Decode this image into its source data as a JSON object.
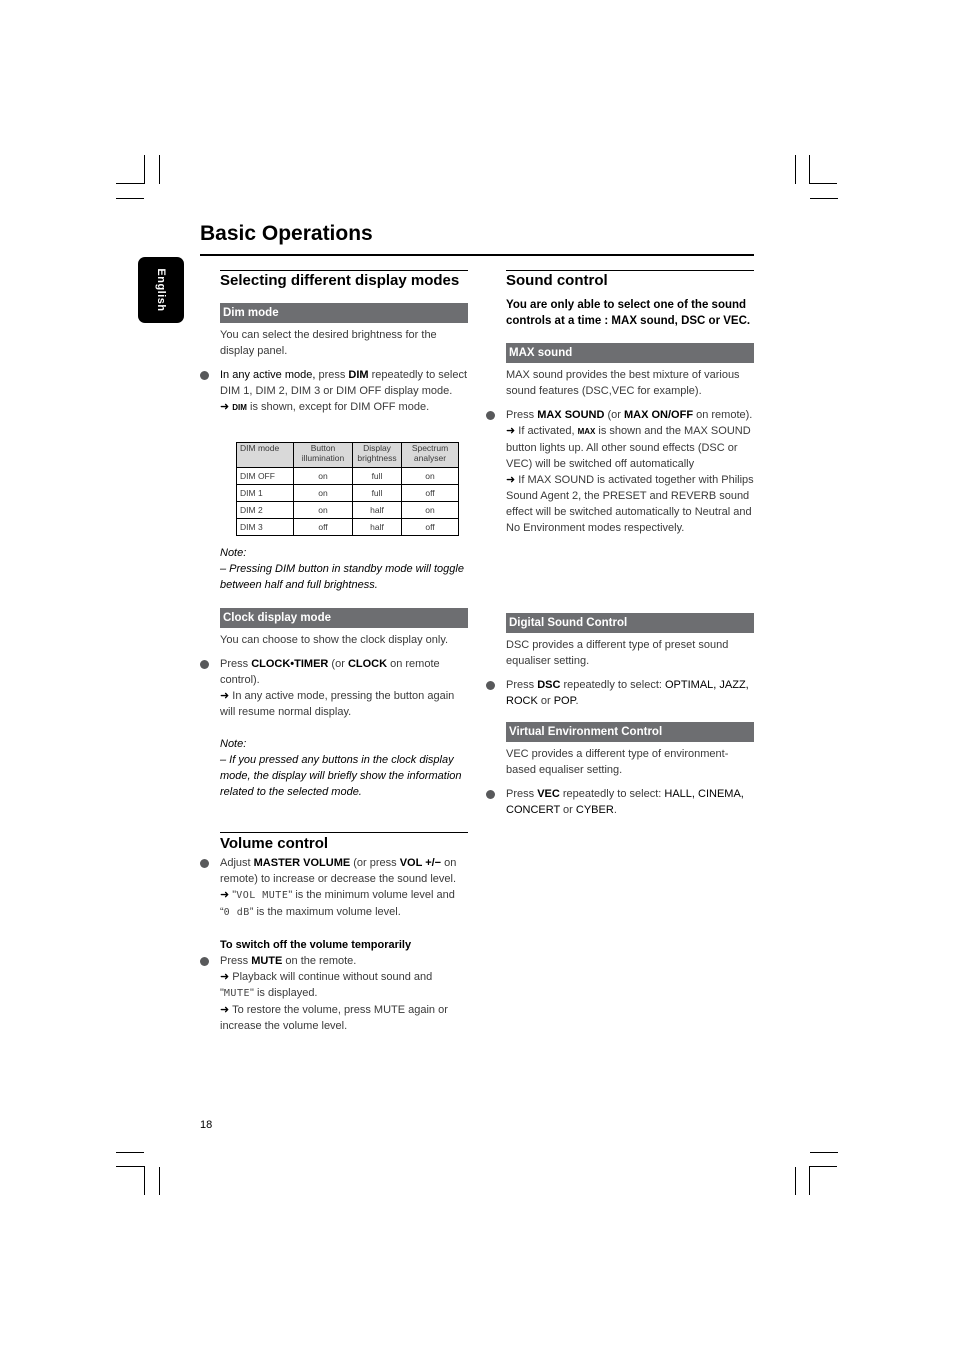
{
  "page": {
    "title": "Basic Operations",
    "language_tab": "English",
    "page_number": "18"
  },
  "left": {
    "display_modes": {
      "title": "Selecting different display modes",
      "dim_mode": {
        "bar": "Dim mode",
        "intro": "You can select the desired brightness for the display panel.",
        "bullet_lead": "In any active mode,",
        "bullet_pre": " press ",
        "bullet_key": "DIM",
        "bullet_post": " repeatedly to select DIM 1, DIM 2, DIM 3 or DIM OFF display mode.",
        "result_icon": "DIM",
        "result_text": " is shown, except for DIM OFF mode.",
        "table": {
          "headers": [
            "DIM mode",
            "Button illumination",
            "Display brightness",
            "Spectrum analyser"
          ],
          "rows": [
            [
              "DIM OFF",
              "on",
              "full",
              "on"
            ],
            [
              "DIM 1",
              "on",
              "full",
              "off"
            ],
            [
              "DIM 2",
              "on",
              "half",
              "on"
            ],
            [
              "DIM 3",
              "off",
              "half",
              "off"
            ]
          ]
        },
        "note_label": "Note:",
        "note_text": "–  Pressing DIM button in standby mode will toggle between half and full brightness."
      },
      "clock_mode": {
        "bar": "Clock display mode",
        "intro": "You can choose to show the clock display only.",
        "bullet_pre": "Press ",
        "bullet_key1": "CLOCK•TIMER",
        "bullet_mid": " (or ",
        "bullet_key2": "CLOCK",
        "bullet_post": " on remote control).",
        "result_text": " In any active mode, pressing the button again will resume normal display.",
        "note_label": "Note:",
        "note_text": "–  If you pressed any buttons in the clock display mode, the display will briefly show the information related to the selected mode."
      }
    },
    "volume": {
      "title": "Volume control",
      "bullet_pre": "Adjust ",
      "bullet_key1": "MASTER VOLUME",
      "bullet_mid": " (or press ",
      "bullet_key2": "VOL  +/−",
      "bullet_post": "  on remote) to increase or decrease the sound level.",
      "result1_a": " \"",
      "result1_lcd": "VOL MUTE",
      "result1_b": "\" is the minimum volume level and “",
      "result1_lcd2": "0 dB",
      "result1_c": "” is the maximum volume level.",
      "subhead": "To switch off the volume temporarily",
      "mute_pre": "Press ",
      "mute_key": "MUTE",
      "mute_post": " on the remote.",
      "mute_result1_a": " Playback will continue without sound and \"",
      "mute_result1_lcd": "MUTE",
      "mute_result1_b": "\" is displayed.",
      "mute_result2": " To restore the volume, press MUTE again or increase the volume level."
    }
  },
  "right": {
    "sound_control": {
      "title": "Sound control",
      "intro": "You are only able to select one of the sound controls at a time : MAX sound, DSC or VEC."
    },
    "max_sound": {
      "bar": "MAX sound",
      "intro": "MAX sound provides the best mixture of various sound features (DSC,VEC for example).",
      "bullet_pre": "Press ",
      "bullet_key1": "MAX SOUND",
      "bullet_mid": " (or ",
      "bullet_key2": "MAX ON/OFF",
      "bullet_post": " on remote).",
      "result1_a": " If activated, ",
      "result1_icon": "MAX",
      "result1_b": " is shown and the MAX SOUND button lights up.  All other sound effects (DSC or VEC) will be switched off automatically",
      "result2": " If MAX SOUND is activated together with Philips Sound Agent 2, the PRESET and REVERB sound effect will be switched automatically to Neutral and No Environment modes respectively."
    },
    "dsc": {
      "bar": "Digital Sound Control",
      "intro": "DSC provides a different type of preset sound equaliser setting.",
      "bullet_pre": "Press ",
      "bullet_key": "DSC",
      "bullet_mid": " repeatedly to select: ",
      "options": "OPTIMAL, JAZZ, ROCK",
      "or": " or ",
      "last": "POP",
      "end": "."
    },
    "vec": {
      "bar": "Virtual Environment Control",
      "intro": "VEC provides a different type of environment-based equaliser setting.",
      "bullet_pre": "Press ",
      "bullet_key": "VEC",
      "bullet_mid": " repeatedly to select: ",
      "options": "HALL, CINEMA, CONCERT",
      "or": " or ",
      "last": "CYBER",
      "end": "."
    }
  },
  "symbols": {
    "arrow": "➜"
  }
}
